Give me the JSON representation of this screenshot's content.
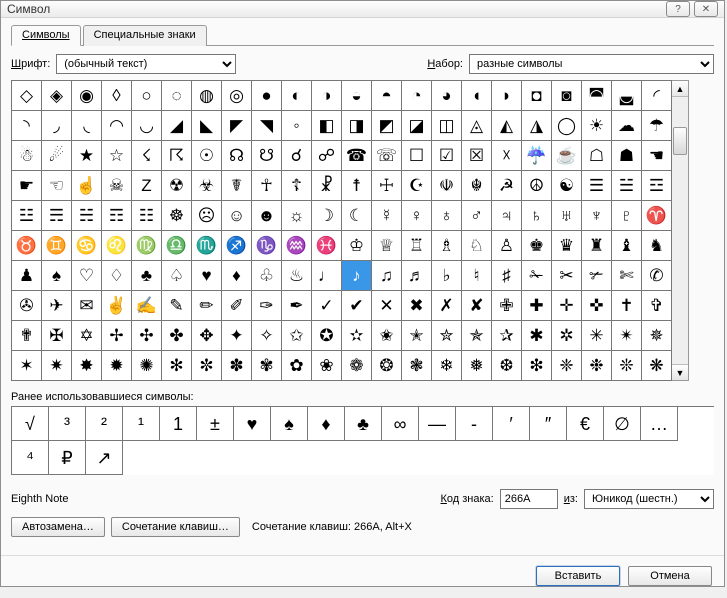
{
  "window": {
    "title": "Символ",
    "help_glyph": "?",
    "close_glyph": "✕"
  },
  "tabs": {
    "symbols": "Символы",
    "special": "Специальные знаки"
  },
  "controls": {
    "font_label": "Шрифт:",
    "font_value": "(обычный текст)",
    "subset_label": "Набор:",
    "subset_value": "разные символы"
  },
  "grid": {
    "symbols": [
      "◇",
      "◈",
      "◉",
      "◊",
      "○",
      "◌",
      "◍",
      "◎",
      "●",
      "◐",
      "◑",
      "◒",
      "◓",
      "◔",
      "◕",
      "◖",
      "◗",
      "◘",
      "◙",
      "◚",
      "◛",
      "◜",
      "◝",
      "◞",
      "◟",
      "◠",
      "◡",
      "◢",
      "◣",
      "◤",
      "◥",
      "◦",
      "◧",
      "◨",
      "◩",
      "◪",
      "◫",
      "◬",
      "◭",
      "◮",
      "◯",
      "☀",
      "☁",
      "☂",
      "☃",
      "☄",
      "★",
      "☆",
      "☇",
      "☈",
      "☉",
      "☊",
      "☋",
      "☌",
      "☍",
      "☎",
      "☏",
      "☐",
      "☑",
      "☒",
      "☓",
      "☔",
      "☕",
      "☖",
      "☗",
      "☚",
      "☛",
      "☜",
      "☝",
      "☠",
      "Z",
      "☢",
      "☣",
      "☤",
      "☥",
      "☦",
      "☧",
      "☨",
      "☩",
      "☪",
      "☫",
      "☬",
      "☭",
      "☮",
      "☯",
      "☰",
      "☱",
      "☲",
      "☳",
      "☴",
      "☵",
      "☶",
      "☷",
      "☸",
      "☹",
      "☺",
      "☻",
      "☼",
      "☽",
      "☾",
      "☿",
      "♀",
      "♁",
      "♂",
      "♃",
      "♄",
      "♅",
      "♆",
      "♇",
      "♈",
      "♉",
      "♊",
      "♋",
      "♌",
      "♍",
      "♎",
      "♏",
      "♐",
      "♑",
      "♒",
      "♓",
      "♔",
      "♕",
      "♖",
      "♗",
      "♘",
      "♙",
      "♚",
      "♛",
      "♜",
      "♝",
      "♞",
      "♟",
      "♠",
      "♡",
      "♢",
      "♣",
      "♤",
      "♥",
      "♦",
      "♧",
      "♨",
      "♩",
      "♪",
      "♫",
      "♬",
      "♭",
      "♮",
      "♯",
      "✁",
      "✂",
      "✃",
      "✄",
      "✆",
      "✇",
      "✈",
      "✉",
      "✌",
      "✍",
      "✎",
      "✏",
      "✐",
      "✑",
      "✒",
      "✓",
      "✔",
      "✕",
      "✖",
      "✗",
      "✘",
      "✙",
      "✚",
      "✛",
      "✜",
      "✝",
      "✞",
      "✟",
      "✠",
      "✡",
      "✢",
      "✣",
      "✤",
      "✥",
      "✦",
      "✧",
      "✩",
      "✪",
      "✫",
      "✬",
      "✭",
      "✮",
      "✯",
      "✰",
      "✱",
      "✲",
      "✳",
      "✴",
      "✵",
      "✶",
      "✷",
      "✸",
      "✹",
      "✺",
      "✻",
      "✼",
      "✽",
      "✾",
      "✿",
      "❀",
      "❁",
      "❂",
      "❃",
      "❄",
      "❅",
      "❆",
      "❇",
      "❈",
      "❉",
      "❊",
      "❋"
    ],
    "selected_index": 143
  },
  "recent": {
    "label": "Ранее использовавшиеся символы:",
    "items": [
      "√",
      "³",
      "²",
      "¹",
      "1",
      "±",
      "♥",
      "♠",
      "♦",
      "♣",
      "∞",
      "—",
      "-",
      "′",
      "″",
      "€",
      "∅",
      "…",
      "⁴",
      "₽",
      "↗"
    ]
  },
  "selected_name": "Eighth Note",
  "code": {
    "label": "Код знака:",
    "value": "266A",
    "from_label": "из:",
    "from_value": "Юникод (шестн.)"
  },
  "buttons": {
    "autocorrect": "Автозамена…",
    "shortcut": "Сочетание клавиш…",
    "shortcut_hint": "Сочетание клавиш: 266A, Alt+X",
    "insert": "Вставить",
    "cancel": "Отмена"
  }
}
